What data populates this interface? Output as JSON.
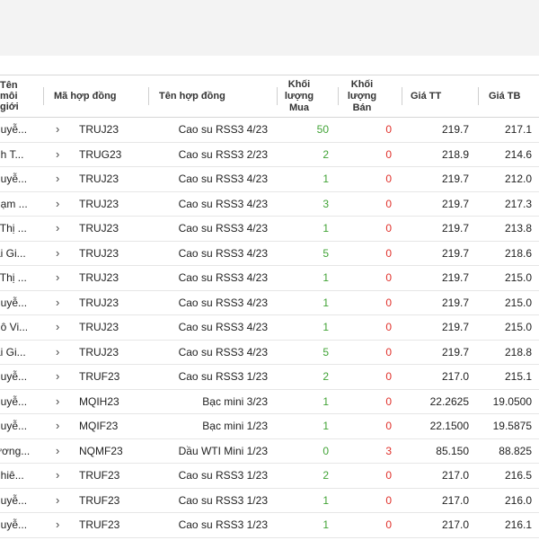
{
  "colors": {
    "buy": "#41a336",
    "sell": "#e0302a",
    "header_bg": "#f3f3f3"
  },
  "headers": {
    "broker": [
      "Tên",
      "môi",
      "giới"
    ],
    "contract_code": "Mã hợp đồng",
    "contract_name": "Tên hợp đồng",
    "buy_volume": [
      "Khối",
      "lượng",
      "Mua"
    ],
    "sell_volume": [
      "Khối",
      "lượng",
      "Bán"
    ],
    "market_price": "Giá TT",
    "avg_price": "Giá TB"
  },
  "rows": [
    {
      "broker": "guyễ...",
      "code": "TRUJ23",
      "name": "Cao su RSS3 4/23",
      "buy": "50",
      "sell": "0",
      "market": "219.7",
      "avg": "217.1"
    },
    {
      "broker": "nh T...",
      "code": "TRUG23",
      "name": "Cao su RSS3 2/23",
      "buy": "2",
      "sell": "0",
      "market": "218.9",
      "avg": "214.6"
    },
    {
      "broker": "guyễ...",
      "code": "TRUJ23",
      "name": "Cao su RSS3 4/23",
      "buy": "1",
      "sell": "0",
      "market": "219.7",
      "avg": "212.0"
    },
    {
      "broker": "hạm ...",
      "code": "TRUJ23",
      "name": "Cao su RSS3 4/23",
      "buy": "3",
      "sell": "0",
      "market": "219.7",
      "avg": "217.3"
    },
    {
      "broker": "ỉ Thị ...",
      "code": "TRUJ23",
      "name": "Cao su RSS3 4/23",
      "buy": "1",
      "sell": "0",
      "market": "219.7",
      "avg": "213.8"
    },
    {
      "broker": "ái Gi...",
      "code": "TRUJ23",
      "name": "Cao su RSS3 4/23",
      "buy": "5",
      "sell": "0",
      "market": "219.7",
      "avg": "218.6"
    },
    {
      "broker": "ỉ Thị ...",
      "code": "TRUJ23",
      "name": "Cao su RSS3 4/23",
      "buy": "1",
      "sell": "0",
      "market": "219.7",
      "avg": "215.0"
    },
    {
      "broker": "guyễ...",
      "code": "TRUJ23",
      "name": "Cao su RSS3 4/23",
      "buy": "1",
      "sell": "0",
      "market": "219.7",
      "avg": "215.0"
    },
    {
      "broker": "gô Vi...",
      "code": "TRUJ23",
      "name": "Cao su RSS3 4/23",
      "buy": "1",
      "sell": "0",
      "market": "219.7",
      "avg": "215.0"
    },
    {
      "broker": "ái Gi...",
      "code": "TRUJ23",
      "name": "Cao su RSS3 4/23",
      "buy": "5",
      "sell": "0",
      "market": "219.7",
      "avg": "218.8"
    },
    {
      "broker": "guyễ...",
      "code": "TRUF23",
      "name": "Cao su RSS3 1/23",
      "buy": "2",
      "sell": "0",
      "market": "217.0",
      "avg": "215.1"
    },
    {
      "broker": "guyễ...",
      "code": "MQIH23",
      "name": "Bạc mini 3/23",
      "buy": "1",
      "sell": "0",
      "market": "22.2625",
      "avg": "19.0500"
    },
    {
      "broker": "guyễ...",
      "code": "MQIF23",
      "name": "Bạc mini 1/23",
      "buy": "1",
      "sell": "0",
      "market": "22.1500",
      "avg": "19.5875"
    },
    {
      "broker": "ương...",
      "code": "NQMF23",
      "name": "Dầu WTI Mini 1/23",
      "buy": "0",
      "sell": "3",
      "market": "85.150",
      "avg": "88.825"
    },
    {
      "broker": "ghiê...",
      "code": "TRUF23",
      "name": "Cao su RSS3 1/23",
      "buy": "2",
      "sell": "0",
      "market": "217.0",
      "avg": "216.5"
    },
    {
      "broker": "guyễ...",
      "code": "TRUF23",
      "name": "Cao su RSS3 1/23",
      "buy": "1",
      "sell": "0",
      "market": "217.0",
      "avg": "216.0"
    },
    {
      "broker": "guyễ...",
      "code": "TRUF23",
      "name": "Cao su RSS3 1/23",
      "buy": "1",
      "sell": "0",
      "market": "217.0",
      "avg": "216.1"
    }
  ]
}
